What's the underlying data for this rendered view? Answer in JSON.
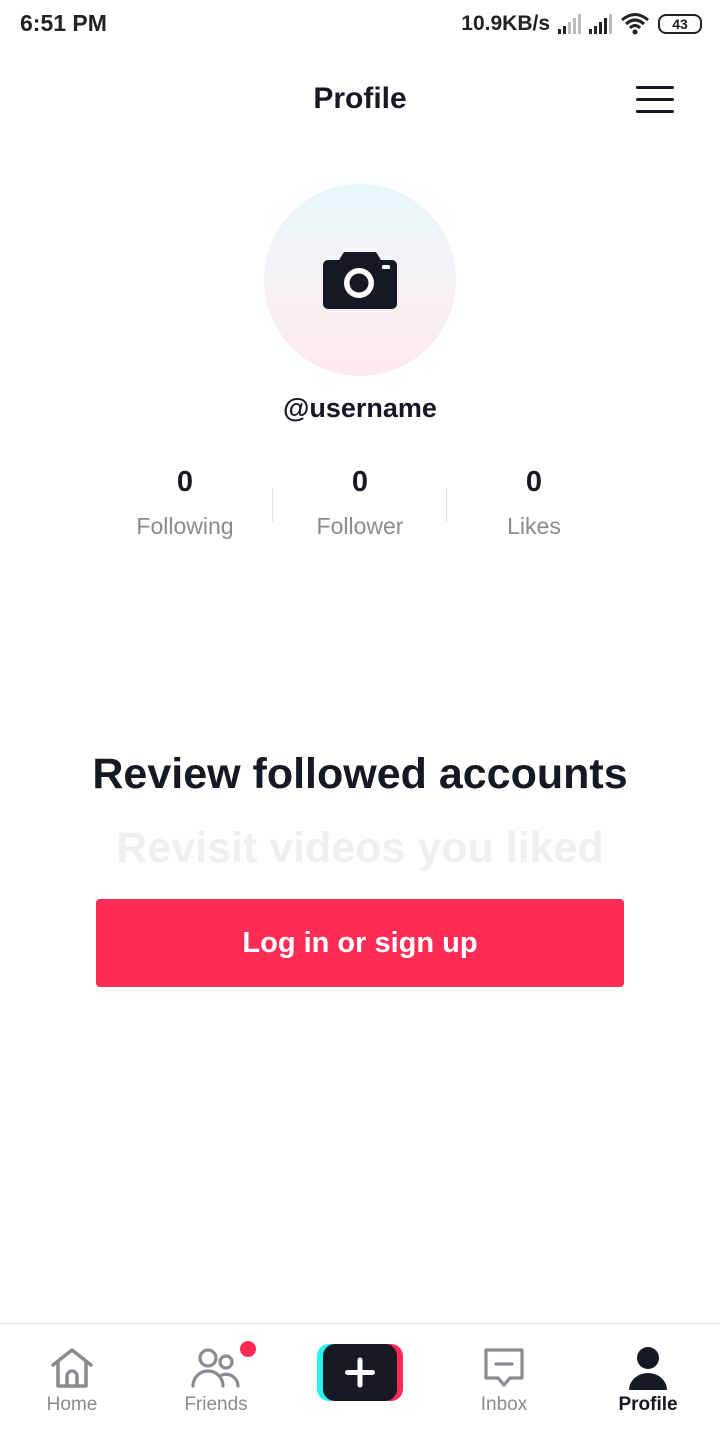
{
  "status_bar": {
    "time": "6:51 PM",
    "net_speed": "10.9KB/s",
    "battery": "43",
    "icons": [
      "signal-icon",
      "signal-icon",
      "wifi-icon",
      "battery-icon"
    ]
  },
  "header": {
    "title": "Profile",
    "menu_icon": "hamburger-menu-icon"
  },
  "profile": {
    "avatar_icon": "camera-icon",
    "username": "@username",
    "stats": [
      {
        "value": "0",
        "label": "Following"
      },
      {
        "value": "0",
        "label": "Follower"
      },
      {
        "value": "0",
        "label": "Likes"
      }
    ]
  },
  "promo": {
    "title": "Review followed accounts",
    "subtitle": "Revisit videos you liked",
    "login_label": "Log in or sign up"
  },
  "bottom_nav": {
    "items": [
      {
        "label": "Home",
        "icon": "home-icon"
      },
      {
        "label": "Friends",
        "icon": "friends-icon",
        "has_badge": true
      },
      {
        "label": "",
        "icon": "plus-icon"
      },
      {
        "label": "Inbox",
        "icon": "inbox-icon"
      },
      {
        "label": "Profile",
        "icon": "profile-icon",
        "active": true
      }
    ]
  },
  "colors": {
    "accent": "#fe2c55",
    "secondary_accent": "#25f4ee",
    "text_primary": "#161823",
    "text_secondary": "#8a8b91"
  }
}
